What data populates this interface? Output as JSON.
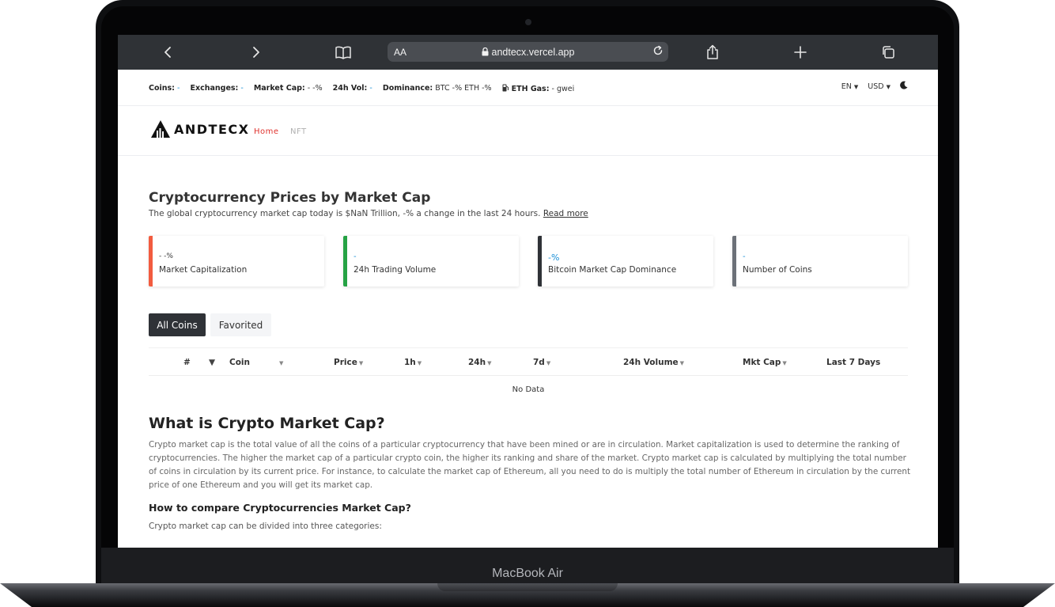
{
  "device": {
    "brand_label": "MacBook Air"
  },
  "browser": {
    "aa_label": "AA",
    "url": "andtecx.vercel.app",
    "icons": [
      "back-icon",
      "forward-icon",
      "bookmarks-icon",
      "lock-icon",
      "reload-icon",
      "share-icon",
      "new-tab-icon",
      "tabs-icon"
    ]
  },
  "statbar": {
    "coins_label": "Coins:",
    "coins_value": "-",
    "exchanges_label": "Exchanges:",
    "exchanges_value": "-",
    "marketcap_label": "Market Cap:",
    "marketcap_value": "- -%",
    "vol_label": "24h Vol:",
    "vol_value": "-",
    "dominance_label": "Dominance:",
    "dominance_value": "BTC -% ETH -%",
    "gas_label": "ETH Gas:",
    "gas_value": "- gwei",
    "language": "EN",
    "currency": "USD"
  },
  "nav": {
    "logo_text": "ANDTECX",
    "links": [
      {
        "label": "Home",
        "active": true
      },
      {
        "label": "NFT",
        "active": false
      }
    ]
  },
  "main": {
    "title": "Cryptocurrency Prices by Market Cap",
    "subtitle": "The global cryptocurrency market cap today is $NaN Trillion,  -% a change in the last 24 hours.",
    "read_more": "Read more",
    "cards": [
      {
        "value": "- -%",
        "label": "Market Capitalization",
        "color": "#f25c3f"
      },
      {
        "value": "-",
        "label": "24h Trading Volume",
        "color": "#25a244"
      },
      {
        "value": "-%",
        "label": "Bitcoin Market Cap Dominance",
        "color": "#2f3237"
      },
      {
        "value": "-",
        "label": "Number of Coins",
        "color": "#6c7178"
      }
    ],
    "tabs": [
      {
        "label": "All Coins",
        "active": true
      },
      {
        "label": "Favorited",
        "active": false
      }
    ],
    "table": {
      "headers": [
        "#",
        "Coin",
        "Price",
        "1h",
        "24h",
        "7d",
        "24h Volume",
        "Mkt Cap",
        "Last 7 Days"
      ],
      "empty_text": "No Data"
    },
    "what_title": "What is Crypto Market Cap?",
    "what_text": "Crypto market cap is the total value of all the coins of a particular cryptocurrency that have been mined or are in circulation. Market capitalization is used to determine the ranking of cryptocurrencies. The higher the market cap of a particular crypto coin, the higher its ranking and share of the market. Crypto market cap is calculated by multiplying the total number of coins in circulation by its current price. For instance, to calculate the market cap of Ethereum, all you need to do is multiply the total number of Ethereum in circulation by the current price of one Ethereum and you will get its market cap.",
    "compare_title": "How to compare Cryptocurrencies Market Cap?",
    "compare_text": "Crypto market cap can be divided into three categories:"
  },
  "colors": {
    "accent_red": "#e0332e",
    "value_blue": "#1a8fd6",
    "dark_button": "#2f3237"
  }
}
